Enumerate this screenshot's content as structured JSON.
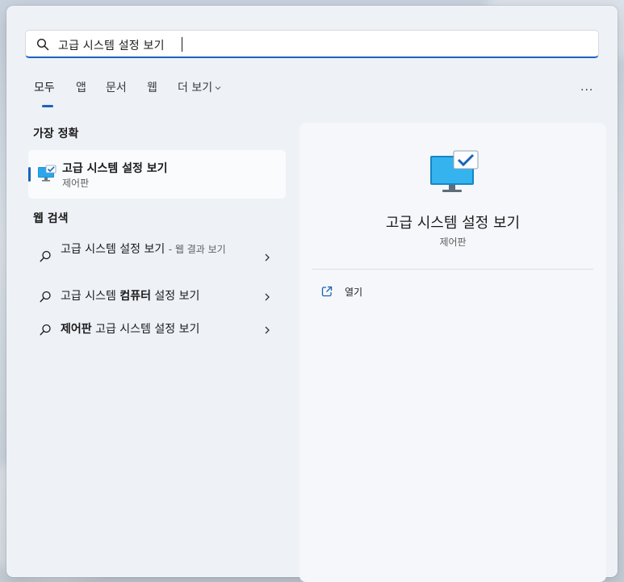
{
  "search": {
    "query": "고급 시스템 설정 보기",
    "icon": "search-icon"
  },
  "tabs": [
    {
      "label": "모두",
      "active": true
    },
    {
      "label": "앱"
    },
    {
      "label": "문서"
    },
    {
      "label": "웹"
    },
    {
      "label": "더 보기"
    }
  ],
  "more_options_label": "···",
  "best_match": {
    "section_title": "가장 정확",
    "title": "고급 시스템 설정 보기",
    "subtitle": "제어판",
    "icon": "control-panel-icon"
  },
  "web_search": {
    "section_title": "웹 검색",
    "items": [
      {
        "text": "고급 시스템 설정 보기",
        "suffix": "- 웹 결과 보기"
      },
      {
        "text_prefix": "고급 시스템 ",
        "text_bold": "컴퓨터",
        "text_suffix": " 설정 보기"
      },
      {
        "text_bold": "제어판",
        "text_suffix": " 고급 시스템 설정 보기"
      }
    ]
  },
  "detail": {
    "title": "고급 시스템 설정 보기",
    "subtitle": "제어판",
    "actions": [
      {
        "label": "열기",
        "icon": "open-external-icon"
      }
    ]
  },
  "colors": {
    "accent": "#1a64b8",
    "panel_bg": "#eef1f6",
    "detail_bg": "#f5f7fa"
  }
}
